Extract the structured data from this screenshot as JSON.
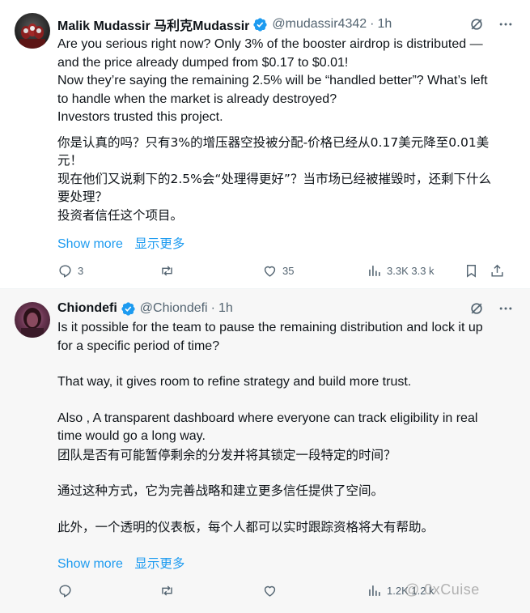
{
  "tweets": [
    {
      "author_name": "Malik Mudassir 马利克Mudassir",
      "handle": "@mudassir4342",
      "time": "1h",
      "body_lines": [
        "Are you serious right now? Only 3% of the booster airdrop is distributed —",
        "and the price already dumped from $0.17 to $0.01!",
        "Now they’re saying the remaining 2.5% will be “handled better”? What’s left",
        "to handle when the market is already destroyed?",
        "Investors trusted this project.",
        "",
        "你是认真的吗？只有3%的增压器空投被分配-价格已经从0.17美元降至0.01美",
        "元！",
        "现在他们又说剩下的2.5%会“处理得更好”？当市场已经被摧毁时，还剩下什么",
        "要处理？",
        "投资者信任这个项目。"
      ],
      "show_more": "Show more",
      "show_more_cn": "显示更多",
      "replies": "3",
      "retweets": "",
      "likes": "35",
      "views": "3.3K 3.3 k"
    },
    {
      "author_name": "Chiondefi",
      "handle": "@Chiondefi",
      "time": "1h",
      "body_lines": [
        "Is it possible for the team to pause the remaining distribution and lock it up",
        "for a specific period of time?",
        "",
        "That way, it gives room to refine strategy and build more trust.",
        "",
        "Also , A transparent dashboard where everyone can track eligibility in real",
        "time would go a long way.",
        "团队是否有可能暂停剩余的分发并将其锁定一段特定的时间？",
        "",
        "通过这种方式，它为完善战略和建立更多信任提供了空间。",
        "",
        "此外，一个透明的仪表板，每个人都可以实时跟踪资格将大有帮助。"
      ],
      "show_more": "Show more",
      "show_more_cn": "显示更多",
      "replies": "",
      "retweets": "",
      "likes": "",
      "views": "1.2K 1.2 k"
    }
  ],
  "watermark": "@ 0xCuise",
  "colors": {
    "accent": "#1d9bf0",
    "muted": "#536471",
    "text": "#0f1419",
    "verified": "#1d9bf0"
  },
  "icons": [
    "verified-badge-icon",
    "grok-icon",
    "more-icon",
    "reply-icon",
    "retweet-icon",
    "like-icon",
    "views-icon",
    "bookmark-icon",
    "share-icon"
  ]
}
